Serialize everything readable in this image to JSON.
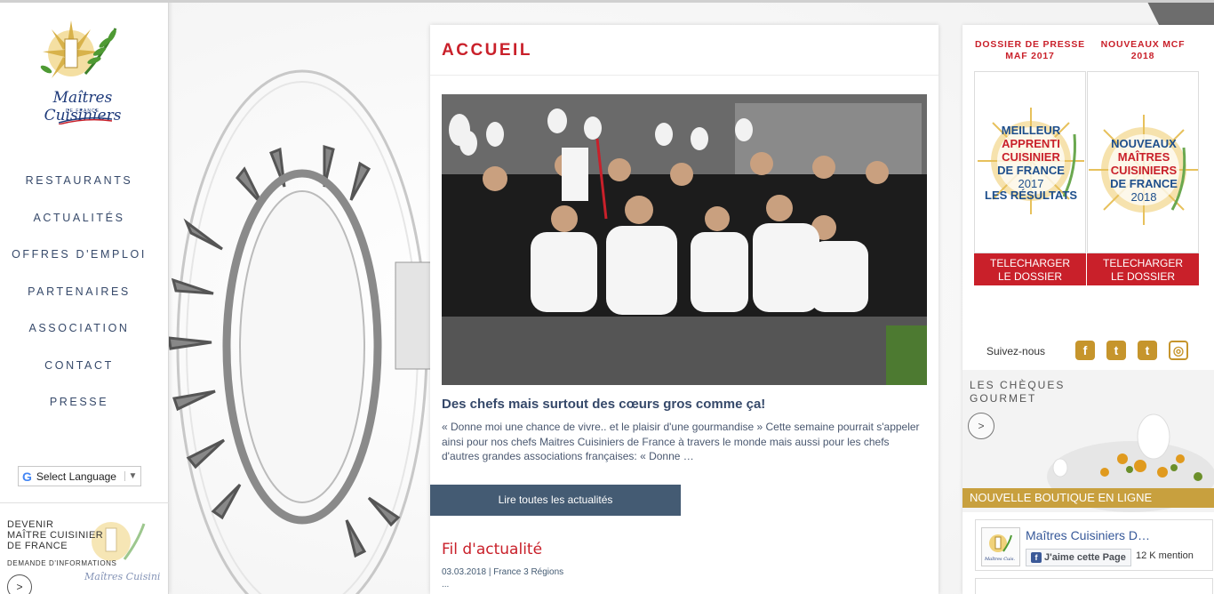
{
  "sidebar": {
    "logo_text": "Maîtres Cuisiniers",
    "logo_sub": "DE FRANCE",
    "nav": [
      {
        "label": "RESTAURANTS"
      },
      {
        "label": "ACTUALITÉS"
      },
      {
        "label": "OFFRES D'EMPLOI"
      },
      {
        "label": "PARTENAIRES"
      },
      {
        "label": "ASSOCIATION"
      },
      {
        "label": "CONTACT"
      },
      {
        "label": "PRESSE"
      }
    ],
    "translate": {
      "label": "Select Language",
      "arrow": "▼",
      "g": "G"
    },
    "devenir": {
      "title": "DEVENIR\nMAÎTRE CUISINIER\nDE FRANCE",
      "demande": "DEMANDE D'INFORMATIONS",
      "arrow": ">"
    }
  },
  "main": {
    "title": "ACCUEIL",
    "headline": "Des chefs mais surtout des cœurs gros comme ça!",
    "excerpt": "« Donne moi une chance de vivre.. et le plaisir d'une gourmandise » Cette semaine pourrait s'appeler ainsi pour nos chefs Maitres Cuisiniers de France à travers le monde mais aussi pour les chefs d'autres grandes associations françaises: « Donne …",
    "read_all_label": "Lire toutes les actualités",
    "fil_title": "Fil d'actualité",
    "fil_meta": "03.03.2018 | France 3 Régions",
    "fil_ellipsis": "..."
  },
  "right": {
    "promo_left": {
      "title": "DOSSIER DE PRESSE\nMAF 2017",
      "badge_lines": [
        "MEILLEUR",
        "APPRENTI",
        "CUISINIER",
        "DE FRANCE",
        "2017",
        "LES RÉSULTATS"
      ],
      "button": "TELECHARGER\nLE DOSSIER"
    },
    "promo_right": {
      "title": "NOUVEAUX MCF\n2018",
      "badge_lines": [
        "NOUVEAUX",
        "MAÎTRES",
        "CUISINIERS",
        "DE FRANCE",
        "2018"
      ],
      "button": "TELECHARGER\nLE DOSSIER"
    },
    "follow_label": "Suivez-nous",
    "social": [
      {
        "name": "facebook",
        "glyph": "f"
      },
      {
        "name": "twitter",
        "glyph": "t"
      },
      {
        "name": "tumblr",
        "glyph": "t"
      },
      {
        "name": "instagram",
        "glyph": "◎"
      }
    ],
    "cheques": {
      "title": "LES CHÈQUES\nGOURMET",
      "arrow": ">",
      "band": "NOUVELLE BOUTIQUE EN LIGNE"
    },
    "facebook": {
      "page_name": "Maîtres Cuisiniers D…",
      "like_label": "J'aime cette Page",
      "count": "12 K mention"
    }
  },
  "colors": {
    "accent_red": "#c9202a",
    "nav_blue": "#36496a",
    "gold": "#c6952c",
    "button_slate": "#445b73"
  }
}
